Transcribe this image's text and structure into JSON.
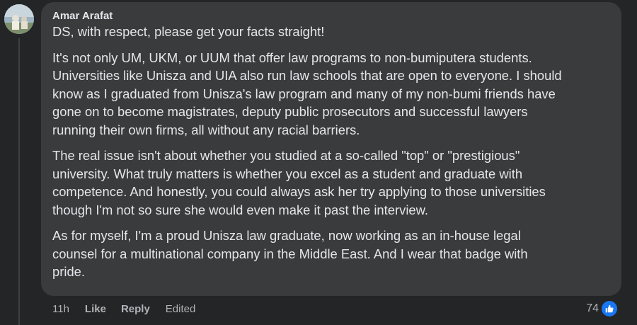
{
  "comment": {
    "author": "Amar Arafat",
    "paragraphs": [
      "DS, with respect, please get your facts straight!",
      "It's not only UM, UKM, or UUM that offer law programs to non-bumiputera students.\nUniversities like Unisza and UIA also run law schools that are open to everyone. I should\nknow as I graduated from Unisza's law program and many of my non-bumi friends have\ngone on to become magistrates, deputy public prosecutors and successful lawyers\nrunning their own firms, all without any racial barriers.",
      "The real issue isn't about whether you studied at a so-called \"top\" or \"prestigious\"\nuniversity. What truly matters is whether you excel as a student and graduate with\ncompetence. And honestly, you could always ask her try applying to those universities\nthough I'm not so sure she would even make it past the interview.",
      "As for myself, I'm a proud Unisza law graduate, now working as an in-house legal\ncounsel for a multinational company in the Middle East. And I wear that badge with\npride."
    ]
  },
  "actions": {
    "time": "11h",
    "like_label": "Like",
    "reply_label": "Reply",
    "edited_label": "Edited"
  },
  "reactions": {
    "count": "74",
    "icon": "thumbs-up-icon",
    "badge_color": "#1877f2"
  }
}
